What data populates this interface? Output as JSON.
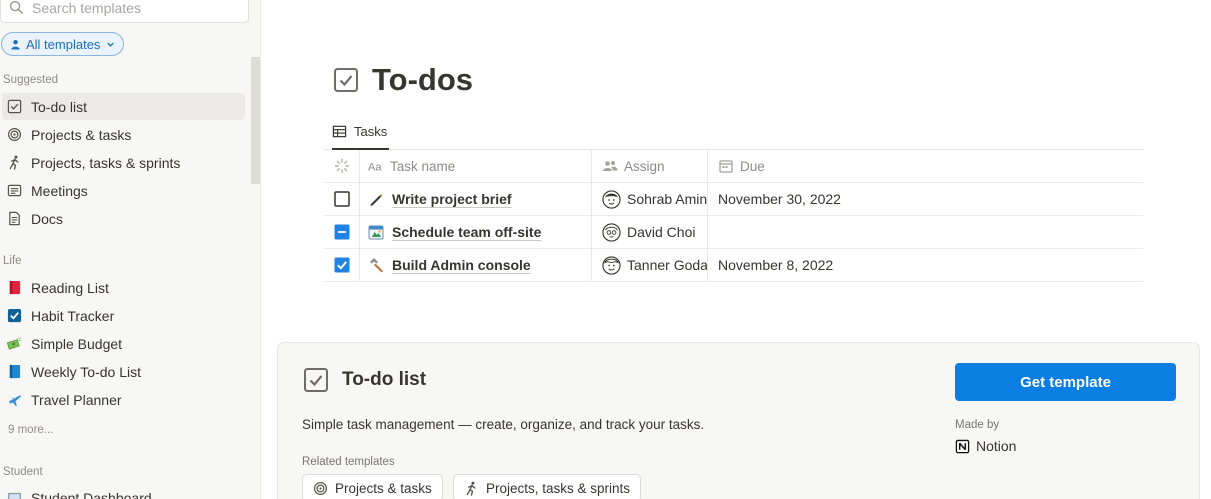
{
  "sidebar": {
    "search_placeholder": "Search templates",
    "filter_label": "All templates",
    "sections": {
      "suggested": "Suggested",
      "life": "Life",
      "student": "Student"
    },
    "suggested_items": [
      {
        "label": "To-do list",
        "icon": "checkbox-icon"
      },
      {
        "label": "Projects & tasks",
        "icon": "target-icon"
      },
      {
        "label": "Projects, tasks & sprints",
        "icon": "runner-icon"
      },
      {
        "label": "Meetings",
        "icon": "meetings-icon"
      },
      {
        "label": "Docs",
        "icon": "doc-icon"
      }
    ],
    "life_items": [
      {
        "label": "Reading List",
        "icon": "red-book-icon"
      },
      {
        "label": "Habit Tracker",
        "icon": "check-mark-icon"
      },
      {
        "label": "Simple Budget",
        "icon": "money-icon"
      },
      {
        "label": "Weekly To-do List",
        "icon": "blue-book-icon"
      },
      {
        "label": "Travel Planner",
        "icon": "airplane-icon"
      }
    ],
    "more_label": "9 more...",
    "student_items": [
      {
        "label": "Student Dashboard",
        "icon": "dashboard-icon"
      }
    ]
  },
  "preview": {
    "title": "To-dos",
    "tab_label": "Tasks",
    "columns": {
      "task": "Task name",
      "assign": "Assign",
      "due": "Due"
    },
    "rows": [
      {
        "task": "Write project brief",
        "assignee": "Sohrab Amin",
        "due": "November 30, 2022",
        "checkbox": "unchecked",
        "icon": "pen-icon"
      },
      {
        "task": "Schedule team off-site",
        "assignee": "David Choi",
        "due": "",
        "checkbox": "indeterminate",
        "icon": "calendar-pin-icon"
      },
      {
        "task": "Build Admin console",
        "assignee": "Tanner Godarzi",
        "due": "November 8, 2022",
        "checkbox": "checked",
        "icon": "hammer-icon"
      }
    ]
  },
  "info": {
    "title": "To-do list",
    "description": "Simple task management — create, organize, and track your tasks.",
    "related_label": "Related templates",
    "related": [
      "Projects & tasks",
      "Projects, tasks & sprints"
    ],
    "cta_label": "Get template",
    "made_by_label": "Made by",
    "maker": "Notion"
  },
  "colors": {
    "accent": "#0b7ee3",
    "sidebar_bg": "#f7f7f5",
    "text": "#37352f"
  }
}
